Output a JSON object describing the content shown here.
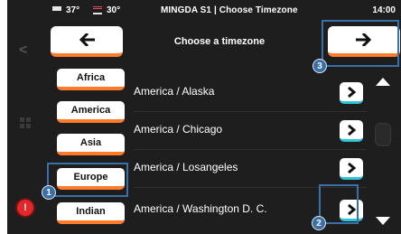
{
  "status": {
    "nozzle_temp": "37°",
    "bed_temp": "30°",
    "title": "MINGDA S1 | Choose Timezone",
    "time": "14:00"
  },
  "header": {
    "heading": "Choose a timezone",
    "back_icon": "arrow-left-icon",
    "next_icon": "arrow-right-icon"
  },
  "regions": [
    {
      "label": "Africa"
    },
    {
      "label": "America"
    },
    {
      "label": "Asia"
    },
    {
      "label": "Europe"
    },
    {
      "label": "Indian"
    }
  ],
  "timezones": [
    {
      "label": "America / Alaska"
    },
    {
      "label": "America / Chicago"
    },
    {
      "label": "America / Losangeles"
    },
    {
      "label": "America / Washington D. C."
    }
  ],
  "callouts": [
    {
      "number": "1"
    },
    {
      "number": "2"
    },
    {
      "number": "3"
    }
  ],
  "colors": {
    "accent_orange": "#ff7a29",
    "accent_cyan": "#2ec4d6",
    "callout_blue": "#3b6fa8",
    "alert_red": "#e3262a"
  }
}
